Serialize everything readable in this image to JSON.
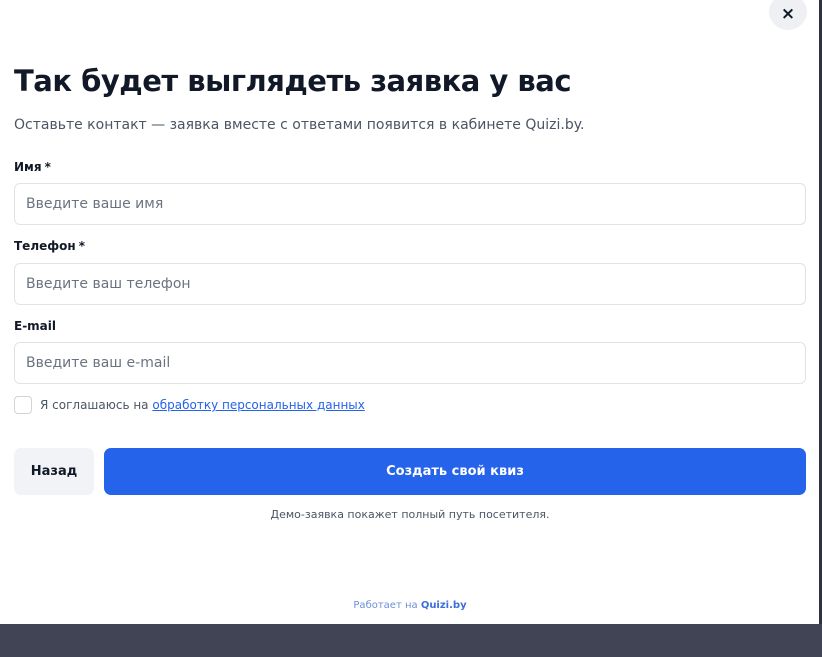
{
  "modal": {
    "close_icon": "×",
    "title": "Так будет выглядеть заявка у вас",
    "subtitle": "Оставьте контакт — заявка вместе с ответами появится в кабинете Quizi.by."
  },
  "form": {
    "name": {
      "label": "Имя",
      "required_mark": "*",
      "placeholder": "Введите ваше имя",
      "value": ""
    },
    "phone": {
      "label": "Телефон",
      "required_mark": "*",
      "placeholder": "Введите ваш телефон",
      "value": ""
    },
    "email": {
      "label": "E-mail",
      "placeholder": "Введите ваш e-mail",
      "value": ""
    },
    "consent": {
      "checked": false,
      "text": "Я соглашаюсь на",
      "link_text": "обработку персональных данных"
    }
  },
  "actions": {
    "back_label": "Назад",
    "create_label": "Создать свой квиз"
  },
  "demo_note": "Демо-заявка покажет полный путь посетителя.",
  "footer": {
    "powered_prefix": "Работает на",
    "powered_brand": "Quizi.by"
  },
  "colors": {
    "accent": "#2563eb",
    "text": "#111827",
    "muted": "#4b5563",
    "footer_band": "#404455"
  }
}
